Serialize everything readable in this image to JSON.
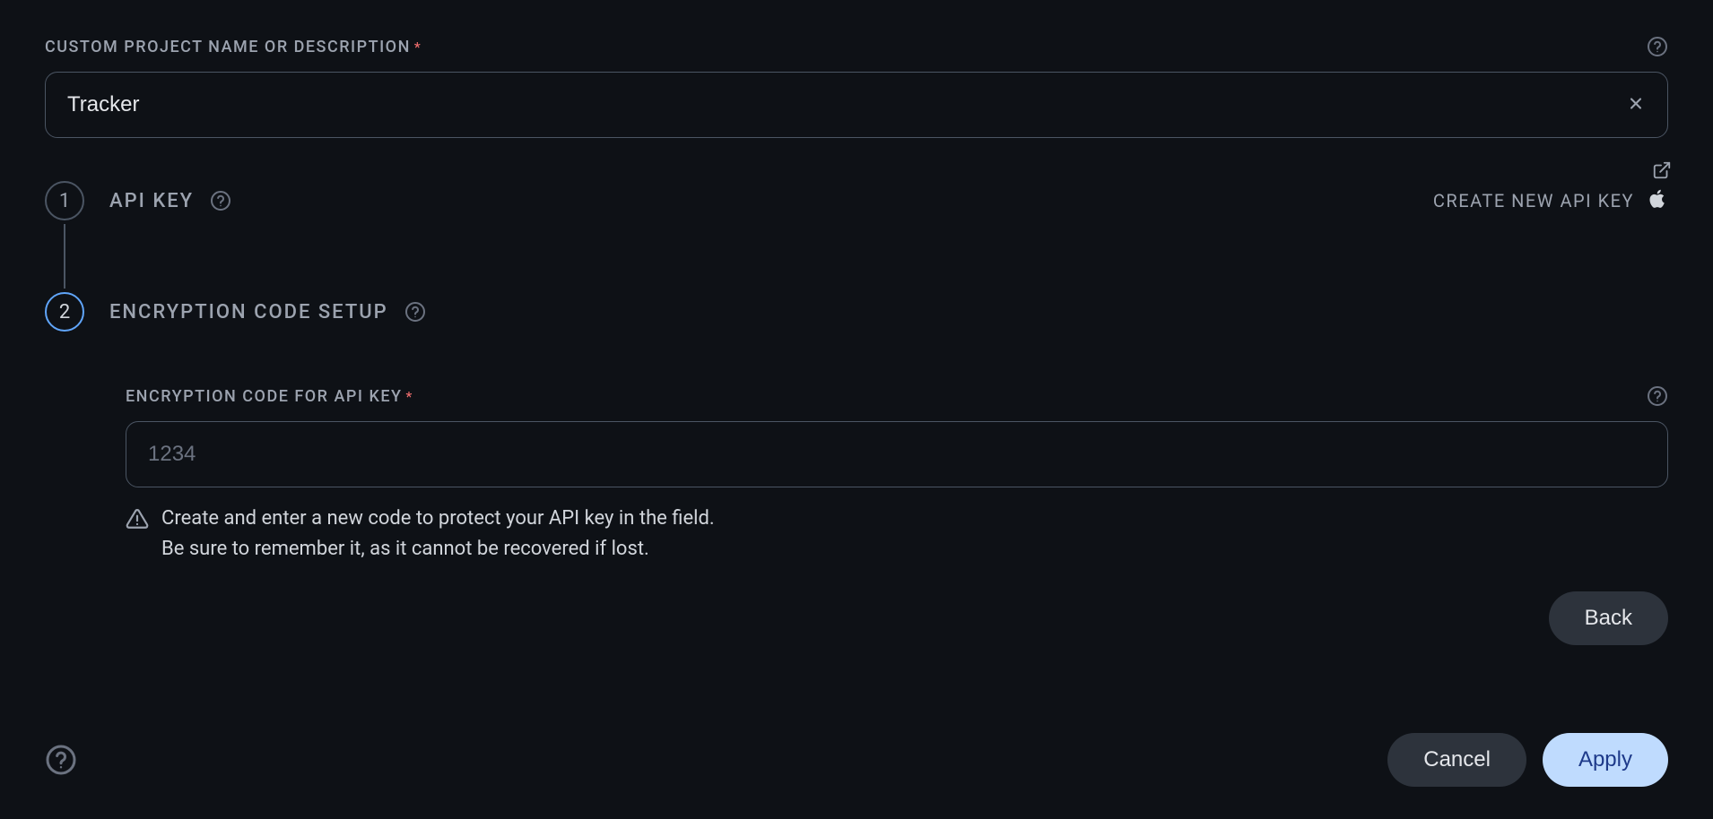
{
  "projectName": {
    "label": "CUSTOM PROJECT NAME OR DESCRIPTION",
    "value": "Tracker"
  },
  "steps": {
    "step1": {
      "number": "1",
      "title": "API KEY",
      "createKey": "CREATE NEW API KEY"
    },
    "step2": {
      "number": "2",
      "title": "ENCRYPTION CODE SETUP",
      "fieldLabel": "ENCRYPTION CODE FOR API KEY",
      "placeholder": "1234",
      "hintLine1": "Create and enter a new code to protect your API key in the field.",
      "hintLine2": "Be sure to remember it, as it cannot be recovered if lost.",
      "backLabel": "Back"
    }
  },
  "footer": {
    "cancel": "Cancel",
    "apply": "Apply"
  }
}
